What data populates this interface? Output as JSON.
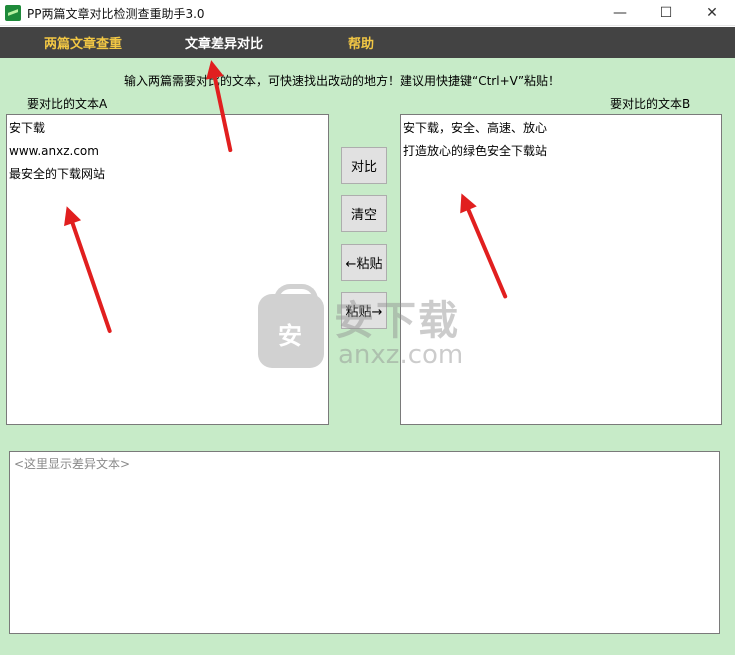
{
  "window": {
    "title": "PP两篇文章对比检测查重助手3.0",
    "controls": {
      "minimize": "—",
      "maximize": "☐",
      "close": "✕"
    }
  },
  "menu": {
    "items": [
      {
        "label": "两篇文章查重"
      },
      {
        "label": "文章差异对比"
      },
      {
        "label": "帮助"
      }
    ]
  },
  "main": {
    "hint": "输入两篇需要对比的文本，可快速找出改动的地方！建议用快捷键“Ctrl+V”粘贴！",
    "label_a": "要对比的文本A",
    "label_b": "要对比的文本B",
    "text_a": [
      "安下载",
      "www.anxz.com",
      "最安全的下载网站"
    ],
    "text_b": [
      "安下载，安全、高速、放心",
      "打造放心的绿色安全下载站"
    ],
    "buttons": {
      "compare": "对比",
      "clear": "清空",
      "paste_left": "←粘贴",
      "paste_right": "粘贴→"
    },
    "diff_placeholder": "<这里显示差异文本>"
  },
  "watermark": {
    "title": "安下载",
    "url": "anxz.com",
    "shield_char": "安"
  },
  "colors": {
    "menubar": "#434343",
    "menu_accent": "#f2c744",
    "client_bg": "#c7ebc8",
    "arrow": "#e11f1f"
  }
}
